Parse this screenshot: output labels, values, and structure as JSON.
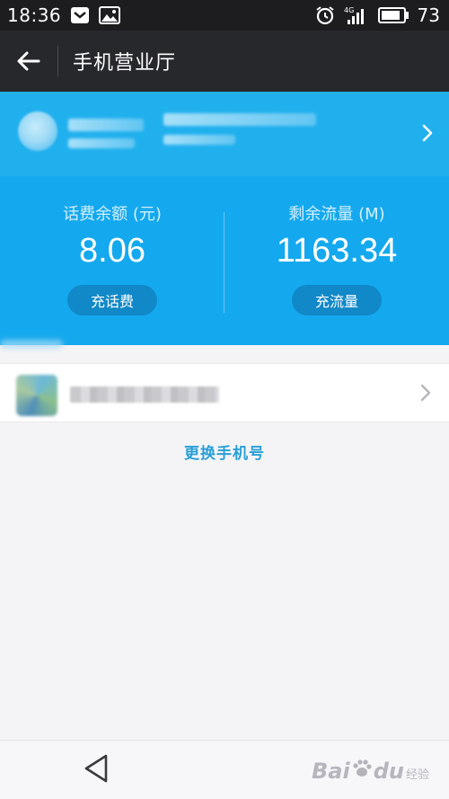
{
  "status_bar": {
    "time": "18:36",
    "network": "4G",
    "battery": "73",
    "icons_left": [
      "notification-icon",
      "image-icon"
    ],
    "icons_right": [
      "alarm-icon",
      "signal-icon",
      "battery-icon"
    ]
  },
  "app_bar": {
    "title": "手机营业厅",
    "back_icon": "arrow-left-icon"
  },
  "account": {
    "chevron_icon": "chevron-right-icon"
  },
  "balance": {
    "label": "话费余额 (元)",
    "value": "8.06",
    "button": "充话费"
  },
  "data_remaining": {
    "label": "剩余流量 (M)",
    "value": "1163.34",
    "button": "充流量"
  },
  "phone_row": {
    "chevron_icon": "chevron-right-icon"
  },
  "change_number": "更换手机号",
  "bottom_nav": {
    "back_icon": "triangle-back-icon"
  },
  "watermark": {
    "brand_left": "Bai",
    "brand_right": "du",
    "sub": "经验"
  },
  "colors": {
    "header_band": "#21b0ee",
    "panel": "#14a9ee",
    "pill_button": "#1188c8",
    "link": "#2a9fd6",
    "app_bar": "#27282c"
  }
}
